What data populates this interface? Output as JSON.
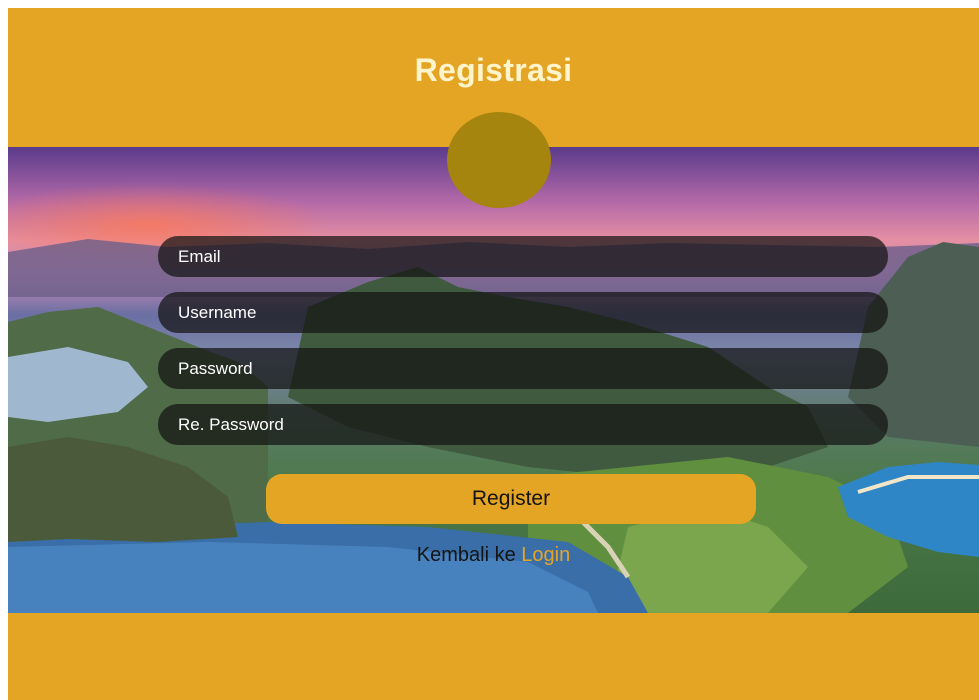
{
  "page": {
    "title": "Registrasi",
    "colors": {
      "background": "#e5a524",
      "avatar": "#a5850e",
      "link": "#e5a524"
    }
  },
  "avatar": {
    "icon": "profile-circle"
  },
  "form": {
    "email_placeholder": "Email",
    "username_placeholder": "Username",
    "password_placeholder": "Password",
    "repassword_placeholder": "Re. Password",
    "register_label": "Register"
  },
  "footer": {
    "back_text": "Kembali ke",
    "login_link": "Login"
  }
}
